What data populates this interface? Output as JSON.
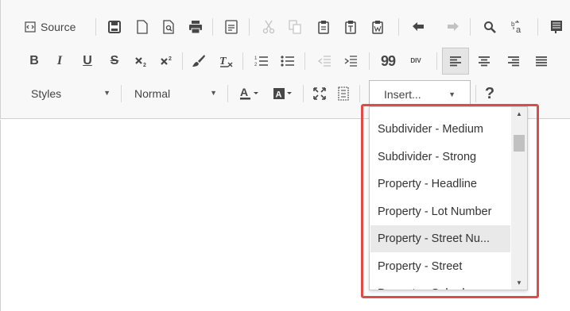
{
  "toolbar": {
    "source_label": "Source",
    "styles_label": "Styles",
    "format_label": "Normal",
    "insert_label": "Insert...",
    "help_label": "?",
    "bold_label": "B",
    "italic_label": "I",
    "underline_label": "U",
    "strike_label": "S",
    "blockquote_label": "99",
    "div_label": "DIV",
    "icons": [
      "source-icon",
      "save-icon",
      "new-page-icon",
      "preview-icon",
      "print-icon",
      "templates-icon",
      "cut-icon",
      "copy-icon",
      "paste-icon",
      "paste-text-icon",
      "paste-word-icon",
      "undo-icon",
      "redo-icon",
      "find-icon",
      "replace-icon",
      "select-all-icon",
      "bold-icon",
      "italic-icon",
      "underline-icon",
      "strike-icon",
      "subscript-icon",
      "superscript-icon",
      "copy-formatting-icon",
      "remove-format-icon",
      "numbered-list-icon",
      "bulleted-list-icon",
      "outdent-icon",
      "indent-icon",
      "blockquote-icon",
      "create-div-icon",
      "align-left-icon",
      "align-center-icon",
      "align-right-icon",
      "align-justify-icon",
      "text-color-icon",
      "background-color-icon",
      "maximize-icon",
      "show-blocks-icon"
    ]
  },
  "insert_dropdown": {
    "items": [
      "Subdivider - Medium",
      "Subdivider - Strong",
      "Property - Headline",
      "Property - Lot Number",
      "Property - Street Nu...",
      "Property - Street",
      "Property - Suburb"
    ],
    "hovered_index": 4
  },
  "colors": {
    "highlight_border": "#e24a4a",
    "toolbar_bg": "#f8f8f8",
    "hover_bg": "#e9e9e9"
  }
}
